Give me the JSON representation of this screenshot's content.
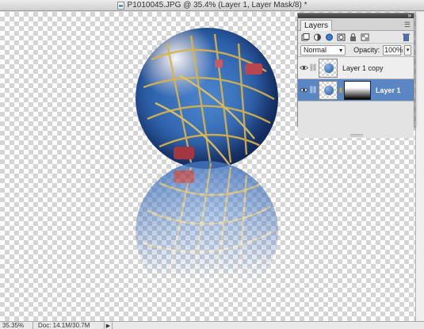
{
  "window": {
    "title": "P1010045.JPG @ 35.4% (Layer 1, Layer Mask/8) *"
  },
  "status_bar": {
    "zoom": "35.35%",
    "doc_info": "Doc: 14.1M/30.7M",
    "arrow": "▶"
  },
  "layers_panel": {
    "tab_label": "Layers",
    "menu_icon": "panel-menu-icon",
    "blend_mode": "Normal",
    "opacity_label": "Opacity:",
    "opacity_value": "100%",
    "layers": [
      {
        "name": "Layer 1 copy",
        "visible": true,
        "selected": false,
        "has_mask": false
      },
      {
        "name": "Layer 1",
        "visible": true,
        "selected": true,
        "has_mask": true
      }
    ]
  },
  "colors": {
    "selection": "#5b86c4",
    "canvas_checker": "#d5d5d5"
  }
}
